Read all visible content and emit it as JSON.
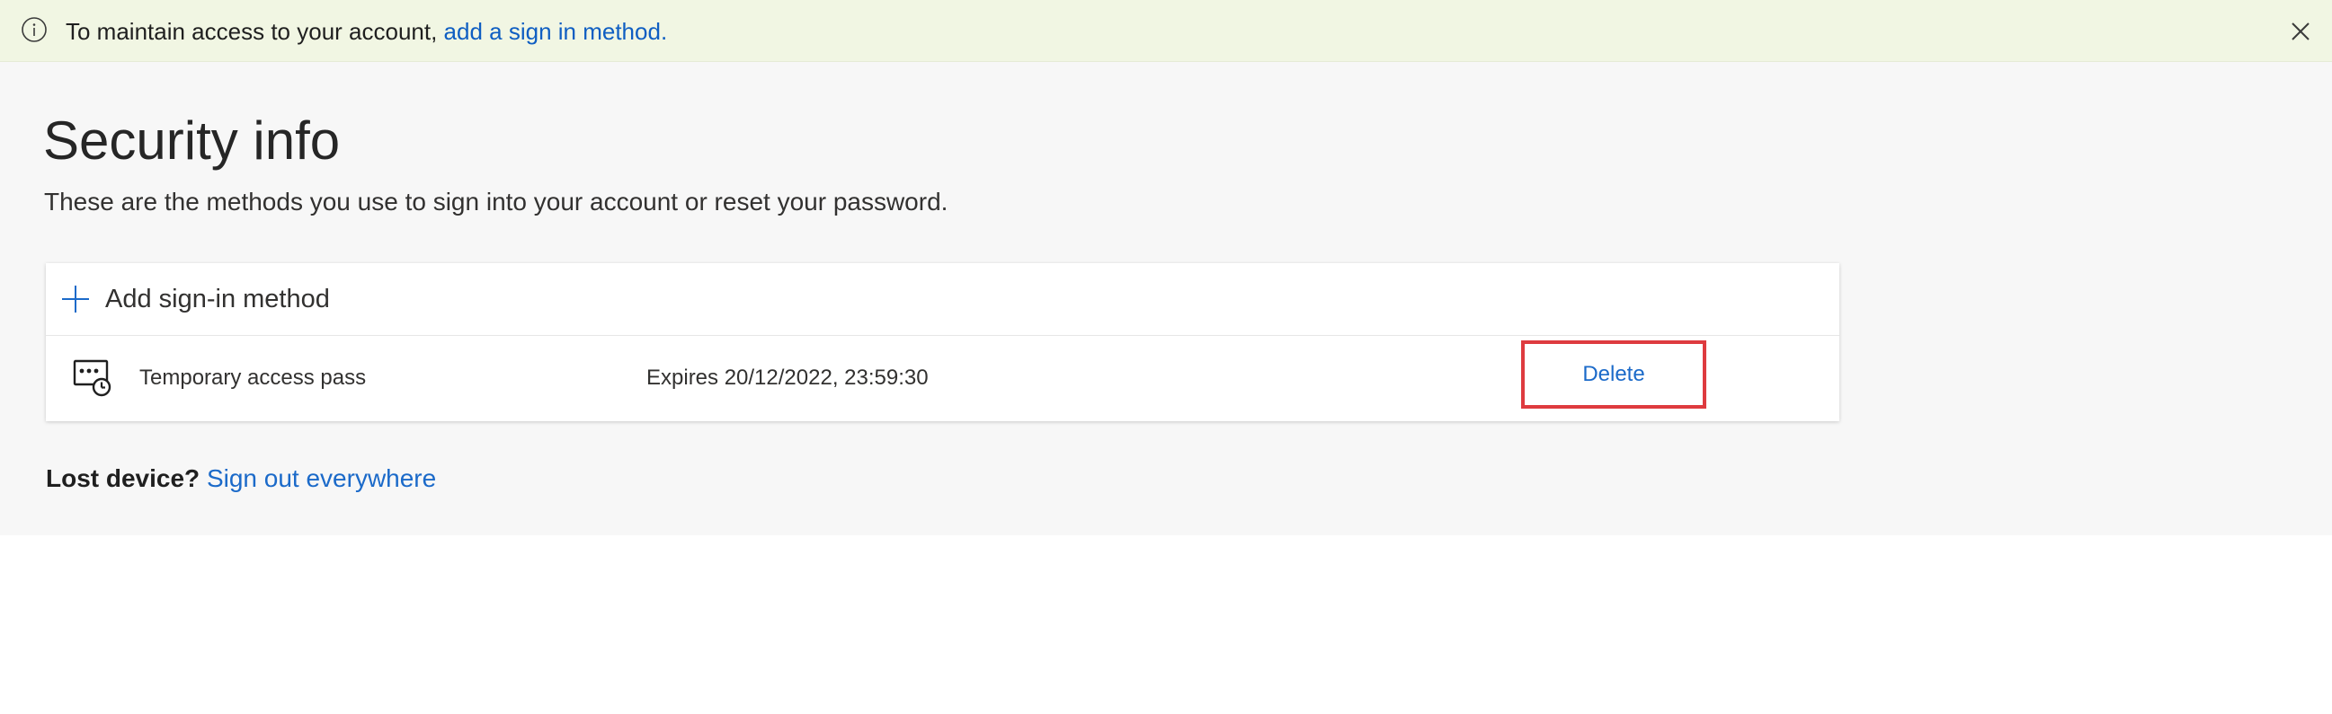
{
  "banner": {
    "message": "To maintain access to your account, ",
    "link_text": "add a sign in method",
    "message_end": ".",
    "info_icon": "info-icon",
    "close_icon": "close-icon"
  },
  "page": {
    "title": "Security info",
    "description": "These are the methods you use to sign into your account or reset your password."
  },
  "methods": {
    "add_label": "Add sign-in method",
    "add_icon": "plus-icon",
    "items": [
      {
        "icon": "temporary-access-pass-icon",
        "name": "Temporary access pass",
        "detail": "Expires 20/12/2022, 23:59:30",
        "action_label": "Delete"
      }
    ]
  },
  "footer": {
    "lost_device_label": "Lost device?",
    "sign_out_link": "Sign out everywhere"
  },
  "colors": {
    "banner_background": "#f1f6e3",
    "content_background": "#f7f7f7",
    "link": "#1b6ac9",
    "highlight_border": "#de3b3f"
  }
}
